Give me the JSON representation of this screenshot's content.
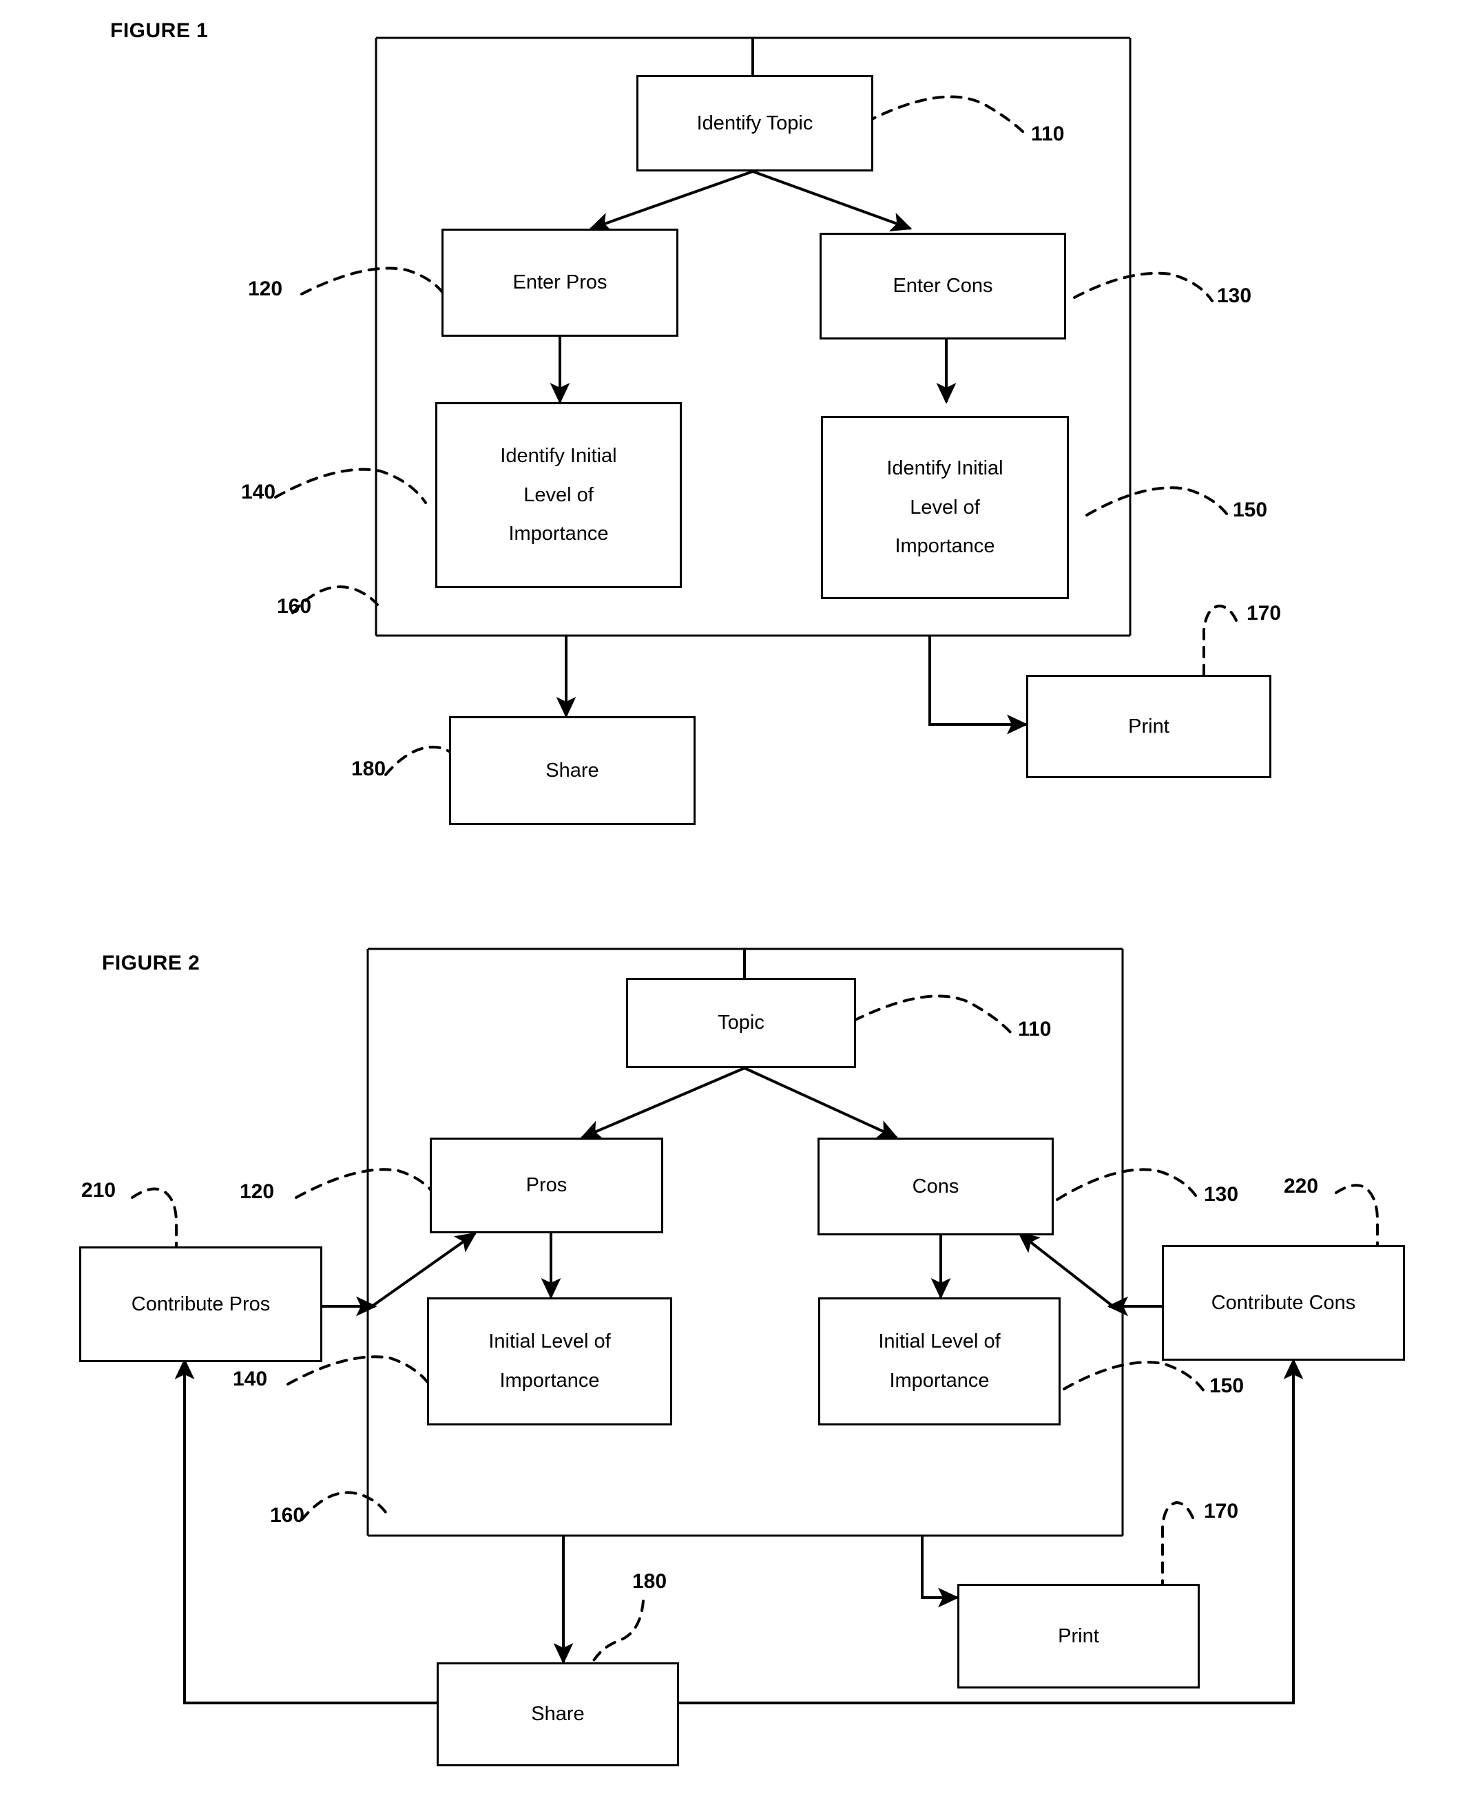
{
  "document": {
    "kind": "patent-drawing-sheet",
    "background_color": "#ffffff",
    "ink_color": "#000000"
  },
  "figures": [
    {
      "id": "figure-1",
      "title": "FIGURE 1",
      "nodes": [
        {
          "key": "identify_topic",
          "label": "Identify Topic"
        },
        {
          "key": "enter_pros",
          "label": "Enter Pros"
        },
        {
          "key": "enter_cons",
          "label": "Enter Cons"
        },
        {
          "key": "identify_initial_level_pros",
          "label": "Identify Initial\nLevel of\nImportance"
        },
        {
          "key": "identify_initial_level_cons",
          "label": "Identify Initial\nLevel of\nImportance"
        },
        {
          "key": "share",
          "label": "Share"
        },
        {
          "key": "print",
          "label": "Print"
        }
      ],
      "refs": [
        {
          "key": "ref_110",
          "label": "110"
        },
        {
          "key": "ref_120",
          "label": "120"
        },
        {
          "key": "ref_130",
          "label": "130"
        },
        {
          "key": "ref_140",
          "label": "140"
        },
        {
          "key": "ref_150",
          "label": "150"
        },
        {
          "key": "ref_160",
          "label": "160"
        },
        {
          "key": "ref_170",
          "label": "170"
        },
        {
          "key": "ref_180",
          "label": "180"
        }
      ]
    },
    {
      "id": "figure-2",
      "title": "FIGURE 2",
      "nodes": [
        {
          "key": "topic",
          "label": "Topic"
        },
        {
          "key": "pros",
          "label": "Pros"
        },
        {
          "key": "cons",
          "label": "Cons"
        },
        {
          "key": "initial_level_pros",
          "label": "Initial Level of\nImportance"
        },
        {
          "key": "initial_level_cons",
          "label": "Initial Level of\nImportance"
        },
        {
          "key": "contribute_pros",
          "label": "Contribute Pros"
        },
        {
          "key": "contribute_cons",
          "label": "Contribute Cons"
        },
        {
          "key": "share",
          "label": "Share"
        },
        {
          "key": "print",
          "label": "Print"
        }
      ],
      "refs": [
        {
          "key": "ref_110",
          "label": "110"
        },
        {
          "key": "ref_120",
          "label": "120"
        },
        {
          "key": "ref_130",
          "label": "130"
        },
        {
          "key": "ref_140",
          "label": "140"
        },
        {
          "key": "ref_150",
          "label": "150"
        },
        {
          "key": "ref_160",
          "label": "160"
        },
        {
          "key": "ref_170",
          "label": "170"
        },
        {
          "key": "ref_180",
          "label": "180"
        },
        {
          "key": "ref_210",
          "label": "210"
        },
        {
          "key": "ref_220",
          "label": "220"
        }
      ]
    }
  ],
  "f1": {
    "title": "FIGURE 1",
    "identify_topic": "Identify Topic",
    "enter_pros": "Enter Pros",
    "enter_cons": "Enter Cons",
    "level_pros_l1": "Identify Initial",
    "level_pros_l2": "Level of",
    "level_pros_l3": "Importance",
    "level_cons_l1": "Identify Initial",
    "level_cons_l2": "Level of",
    "level_cons_l3": "Importance",
    "share": "Share",
    "print": "Print",
    "ref110": "110",
    "ref120": "120",
    "ref130": "130",
    "ref140": "140",
    "ref150": "150",
    "ref160": "160",
    "ref170": "170",
    "ref180": "180"
  },
  "f2": {
    "title": "FIGURE 2",
    "topic": "Topic",
    "pros": "Pros",
    "cons": "Cons",
    "level_pros_l1": "Initial Level of",
    "level_pros_l2": "Importance",
    "level_cons_l1": "Initial Level of",
    "level_cons_l2": "Importance",
    "contribute_pros": "Contribute Pros",
    "contribute_cons": "Contribute Cons",
    "share": "Share",
    "print": "Print",
    "ref110": "110",
    "ref120": "120",
    "ref130": "130",
    "ref140": "140",
    "ref150": "150",
    "ref160": "160",
    "ref170": "170",
    "ref180": "180",
    "ref210": "210",
    "ref220": "220"
  }
}
